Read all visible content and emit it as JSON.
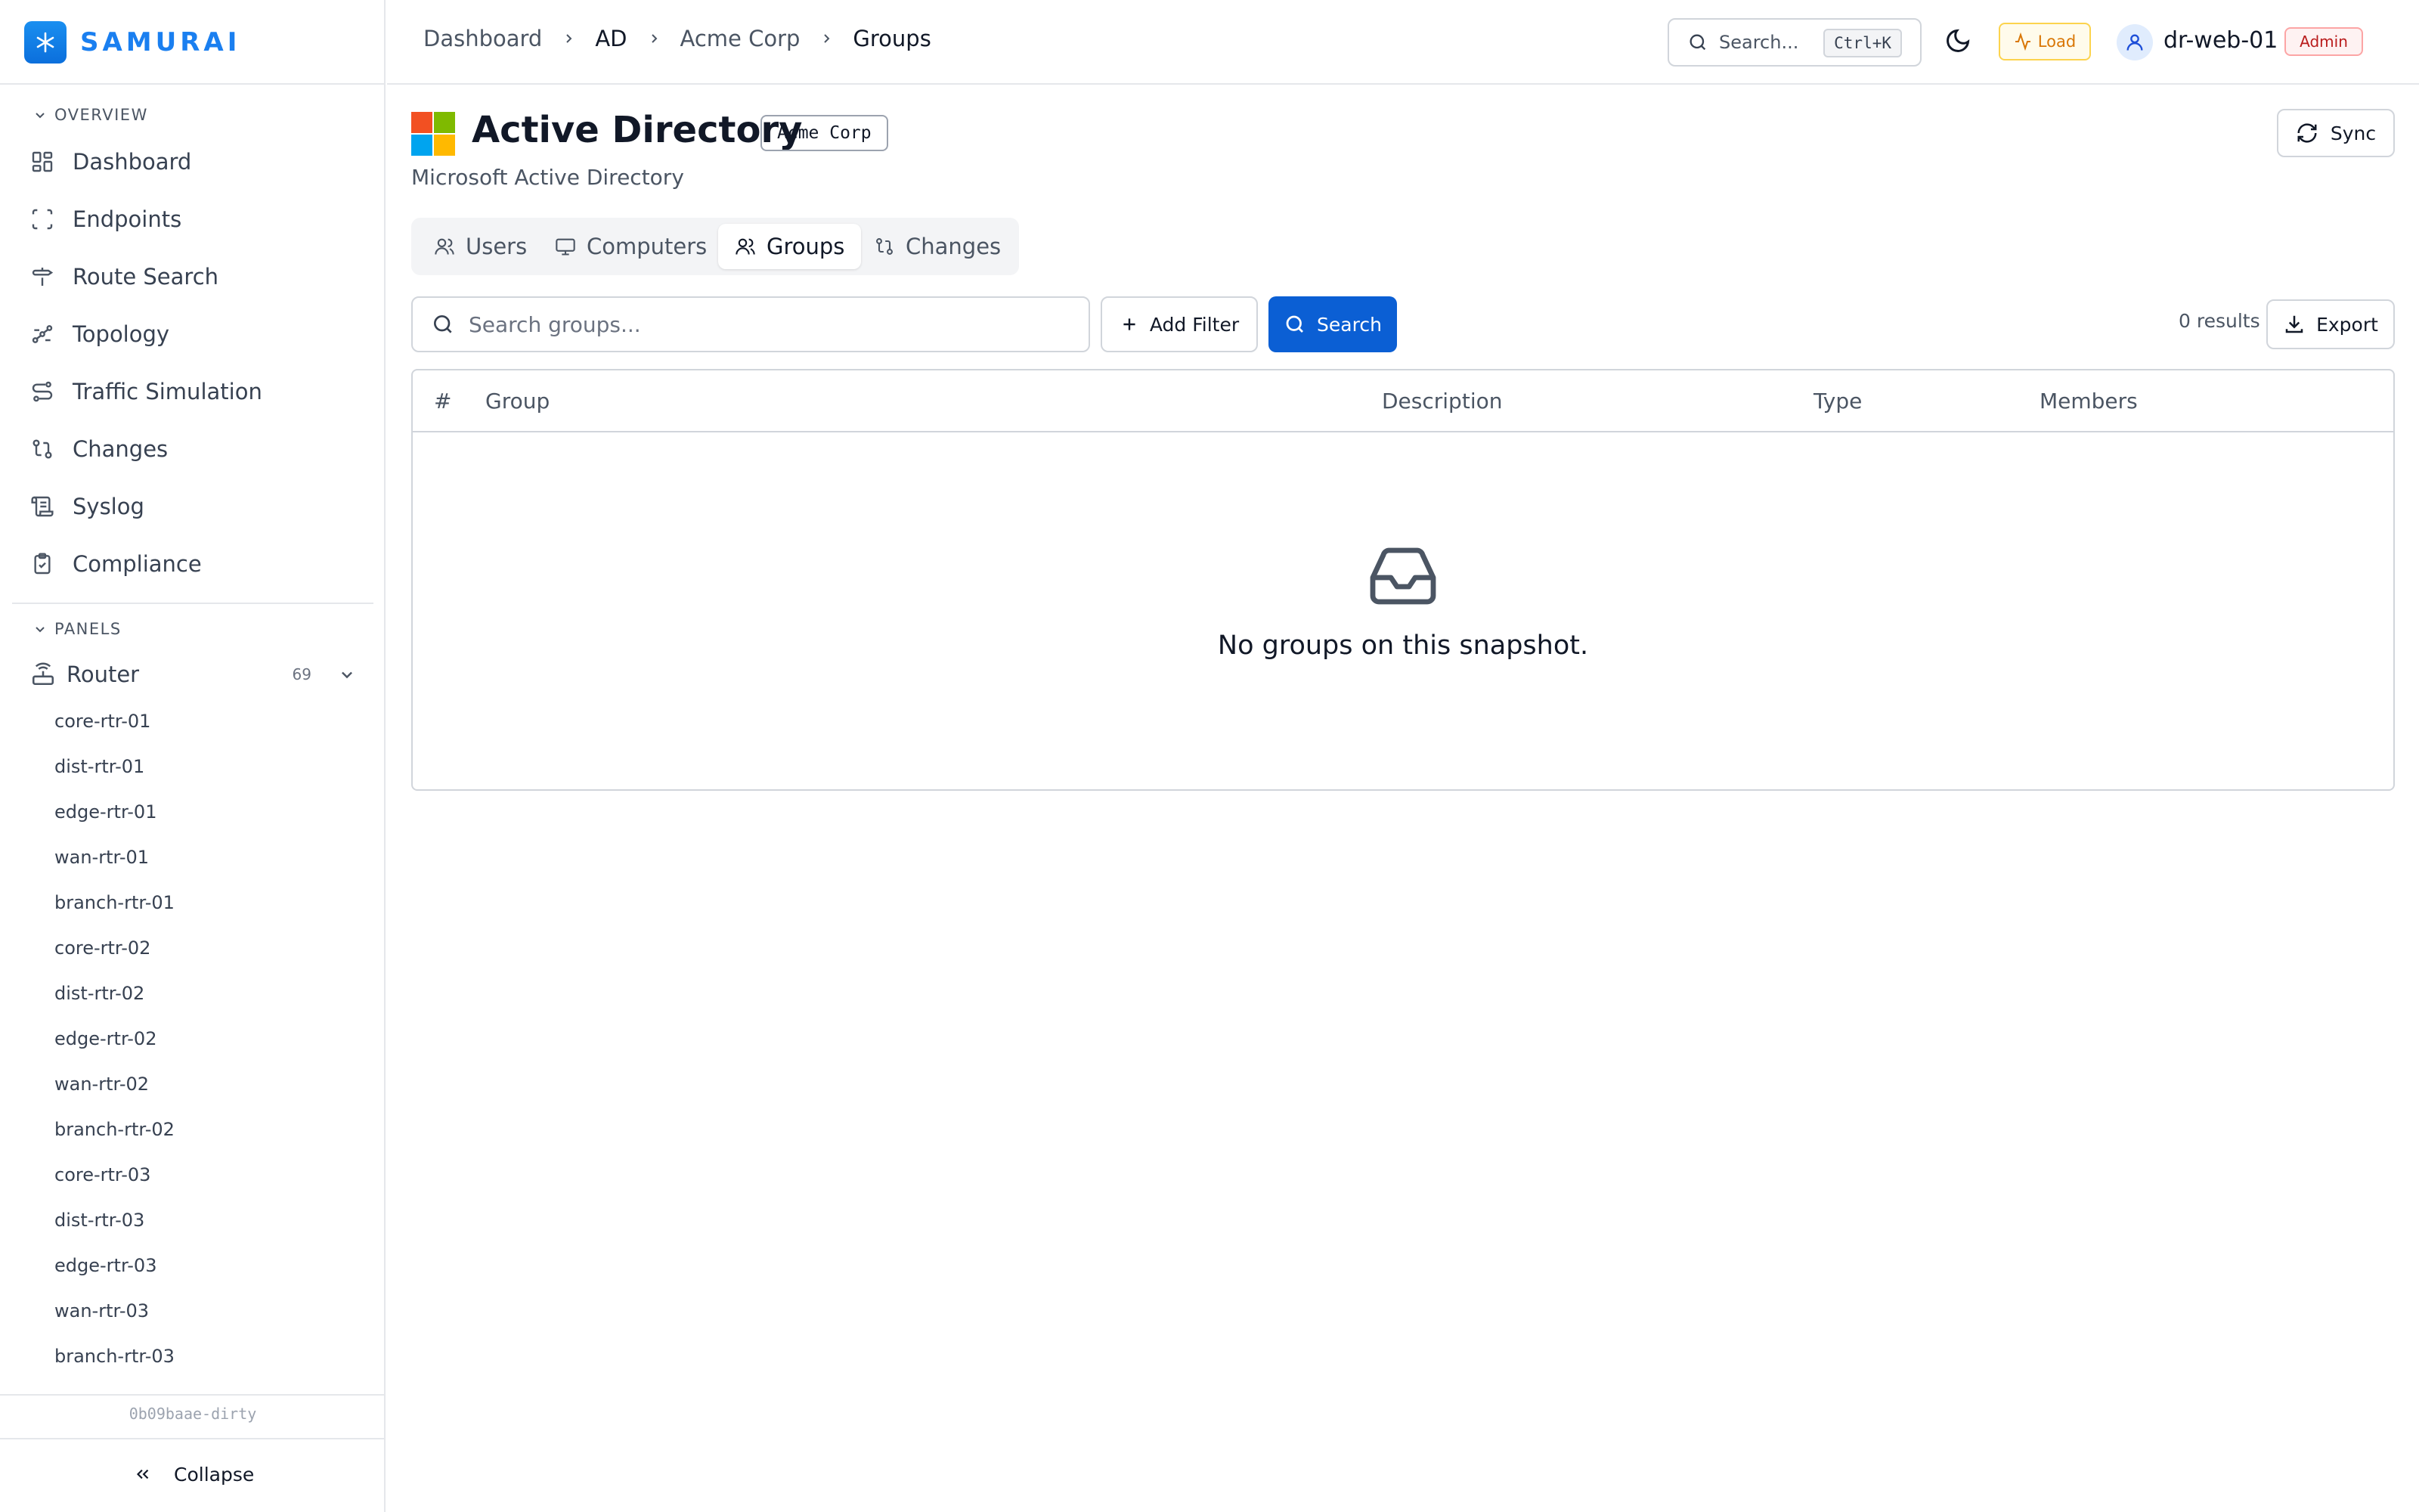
{
  "brand": {
    "name": "SAMURAI"
  },
  "sidebar": {
    "overview_label": "OVERVIEW",
    "items": [
      {
        "label": "Dashboard",
        "icon": "grid-icon"
      },
      {
        "label": "Endpoints",
        "icon": "scan-icon"
      },
      {
        "label": "Route Search",
        "icon": "signpost-icon"
      },
      {
        "label": "Topology",
        "icon": "topology-icon"
      },
      {
        "label": "Traffic Simulation",
        "icon": "route-icon"
      },
      {
        "label": "Changes",
        "icon": "git-compare-icon"
      },
      {
        "label": "Syslog",
        "icon": "scroll-icon"
      },
      {
        "label": "Compliance",
        "icon": "clipboard-check-icon"
      }
    ],
    "panels_label": "PANELS",
    "router": {
      "label": "Router",
      "count": "69"
    },
    "devices": [
      "core-rtr-01",
      "dist-rtr-01",
      "edge-rtr-01",
      "wan-rtr-01",
      "branch-rtr-01",
      "core-rtr-02",
      "dist-rtr-02",
      "edge-rtr-02",
      "wan-rtr-02",
      "branch-rtr-02",
      "core-rtr-03",
      "dist-rtr-03",
      "edge-rtr-03",
      "wan-rtr-03",
      "branch-rtr-03"
    ],
    "version": "0b09baae-dirty",
    "collapse_label": "Collapse"
  },
  "topbar": {
    "breadcrumbs": [
      "Dashboard",
      "AD",
      "Acme Corp",
      "Groups"
    ],
    "search_placeholder": "Search...",
    "search_shortcut": "Ctrl+K",
    "load_label": "Load",
    "username": "dr-web-01",
    "role": "Admin"
  },
  "page": {
    "title": "Active Directory",
    "org_badge": "Acme Corp",
    "subtitle": "Microsoft Active Directory",
    "sync_label": "Sync"
  },
  "tabs": [
    {
      "label": "Users",
      "active": false
    },
    {
      "label": "Computers",
      "active": false
    },
    {
      "label": "Groups",
      "active": true
    },
    {
      "label": "Changes",
      "active": false
    }
  ],
  "toolbar": {
    "search_placeholder": "Search groups...",
    "add_filter_label": "Add Filter",
    "search_label": "Search",
    "results_text": "0 results",
    "export_label": "Export"
  },
  "table": {
    "columns": [
      "#",
      "Group",
      "Description",
      "Type",
      "Members"
    ],
    "rows": [],
    "empty_text": "No groups on this snapshot."
  },
  "colors": {
    "brand": "#1a7ff0",
    "primary_button": "#0b5fd4",
    "admin_badge": "#b91c1c",
    "load_badge": "#d97706"
  }
}
